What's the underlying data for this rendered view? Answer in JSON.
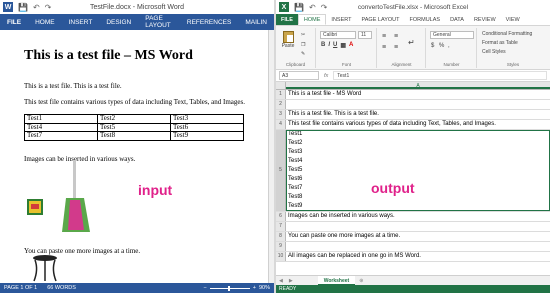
{
  "word": {
    "title": "TestFile.docx - Microsoft Word",
    "tabs": [
      "FILE",
      "HOME",
      "INSERT",
      "DESIGN",
      "PAGE LAYOUT",
      "REFERENCES",
      "MAILIN"
    ],
    "doc": {
      "heading": "This is a test file – MS Word",
      "para1": "This is a test file. This is a test file.",
      "para2": "This test file contains various types of data including Text, Tables, and Images.",
      "table": [
        [
          "Test1",
          "Test2",
          "Test3"
        ],
        [
          "Test4",
          "Test5",
          "Test6"
        ],
        [
          "Test7",
          "Test8",
          "Test9"
        ]
      ],
      "para3": "Images can be inserted in various ways.",
      "para4": "You can paste one more images at a time."
    },
    "status": {
      "page": "PAGE 1 OF 1",
      "words": "66 WORDS",
      "zoom": "90%"
    },
    "overlay_label": "input"
  },
  "excel": {
    "title": "convertoTestFile.xlsx - Microsoft Excel",
    "tabs": [
      "FILE",
      "HOME",
      "INSERT",
      "PAGE LAYOUT",
      "FORMULAS",
      "DATA",
      "REVIEW",
      "VIEW"
    ],
    "ribbon": {
      "paste": "Paste",
      "font_name": "Calibri",
      "font_size": "11",
      "number_format": "General",
      "styles": [
        "Conditional Formatting",
        "Format as Table",
        "Cell Styles"
      ],
      "groups": [
        "Clipboard",
        "Font",
        "Alignment",
        "Number",
        "Styles"
      ]
    },
    "namebox": "A3",
    "formula": "Test1",
    "column": "A",
    "rows": [
      {
        "num": "1",
        "lines": [
          "This is a test file - MS Word"
        ]
      },
      {
        "num": "2",
        "lines": [
          ""
        ]
      },
      {
        "num": "3",
        "lines": [
          "This is a test file. This is a test file."
        ]
      },
      {
        "num": "4",
        "lines": [
          "This test file contains various types of data including Text, Tables, and Images."
        ]
      },
      {
        "num": "5",
        "lines": [
          "Test1",
          "Test2",
          "Test3",
          "Test4",
          "Test5",
          "Test6",
          "Test7",
          "Test8",
          "Test9"
        ]
      },
      {
        "num": "6",
        "lines": [
          "Images can be inserted in various ways."
        ]
      },
      {
        "num": "7",
        "lines": [
          ""
        ]
      },
      {
        "num": "8",
        "lines": [
          "You can paste one more images at a time."
        ]
      },
      {
        "num": "9",
        "lines": [
          ""
        ]
      },
      {
        "num": "10",
        "lines": [
          "All images can be replaced in one go in MS Word."
        ]
      }
    ],
    "sheet_tab": "Worksheet",
    "status": "READY",
    "overlay_label": "output"
  },
  "colors": {
    "word_blue": "#2b579a",
    "excel_green": "#217346",
    "overlay_pink": "#e0218a"
  }
}
